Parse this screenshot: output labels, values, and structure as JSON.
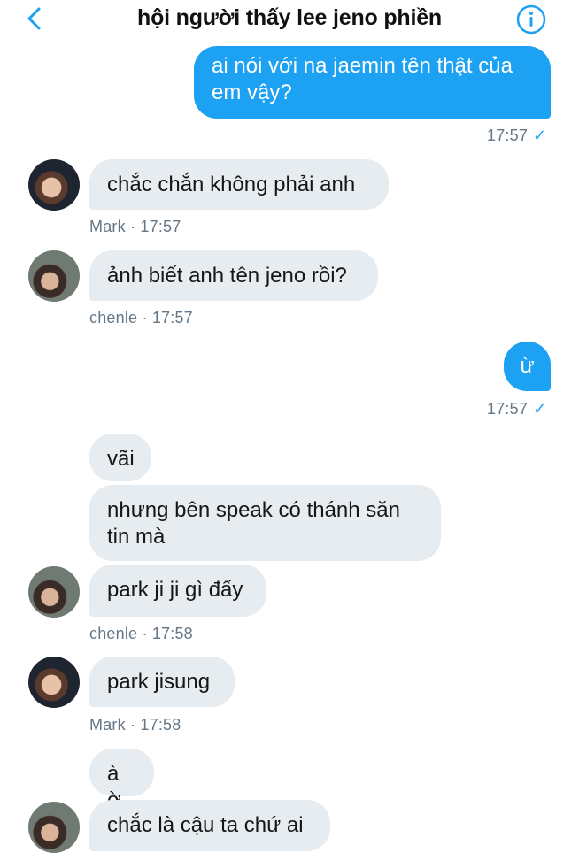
{
  "header": {
    "title": "hội người thấy lee jeno phiền"
  },
  "messages": {
    "m1": {
      "text": "ai nói với na jaemin tên thật của\nem vậy?",
      "time": "17:57"
    },
    "m2": {
      "text": "chắc chắn không phải anh",
      "sender": "Mark",
      "time": "· 17:57"
    },
    "m3": {
      "text": "ảnh biết anh tên jeno rồi?",
      "sender": "chenle",
      "time": "· 17:57"
    },
    "m4": {
      "text": "ừ",
      "time": "17:57"
    },
    "m5": {
      "text": "vãi"
    },
    "m6": {
      "text": "nhưng bên speak có thánh săn\ntin mà"
    },
    "m7": {
      "text": "park ji ji gì đấy",
      "sender": "chenle",
      "time": "· 17:58"
    },
    "m8": {
      "text": "park jisung",
      "sender": "Mark",
      "time": "· 17:58"
    },
    "m9": {
      "text": "à ờ"
    },
    "m10": {
      "text": "chắc là cậu ta chứ ai"
    }
  },
  "icons": {
    "back": "chevron-left-icon",
    "info": "info-icon",
    "read": "check-icon"
  },
  "colors": {
    "accent": "#1da1f2",
    "incoming": "#e6ecf0",
    "meta": "#657786"
  }
}
